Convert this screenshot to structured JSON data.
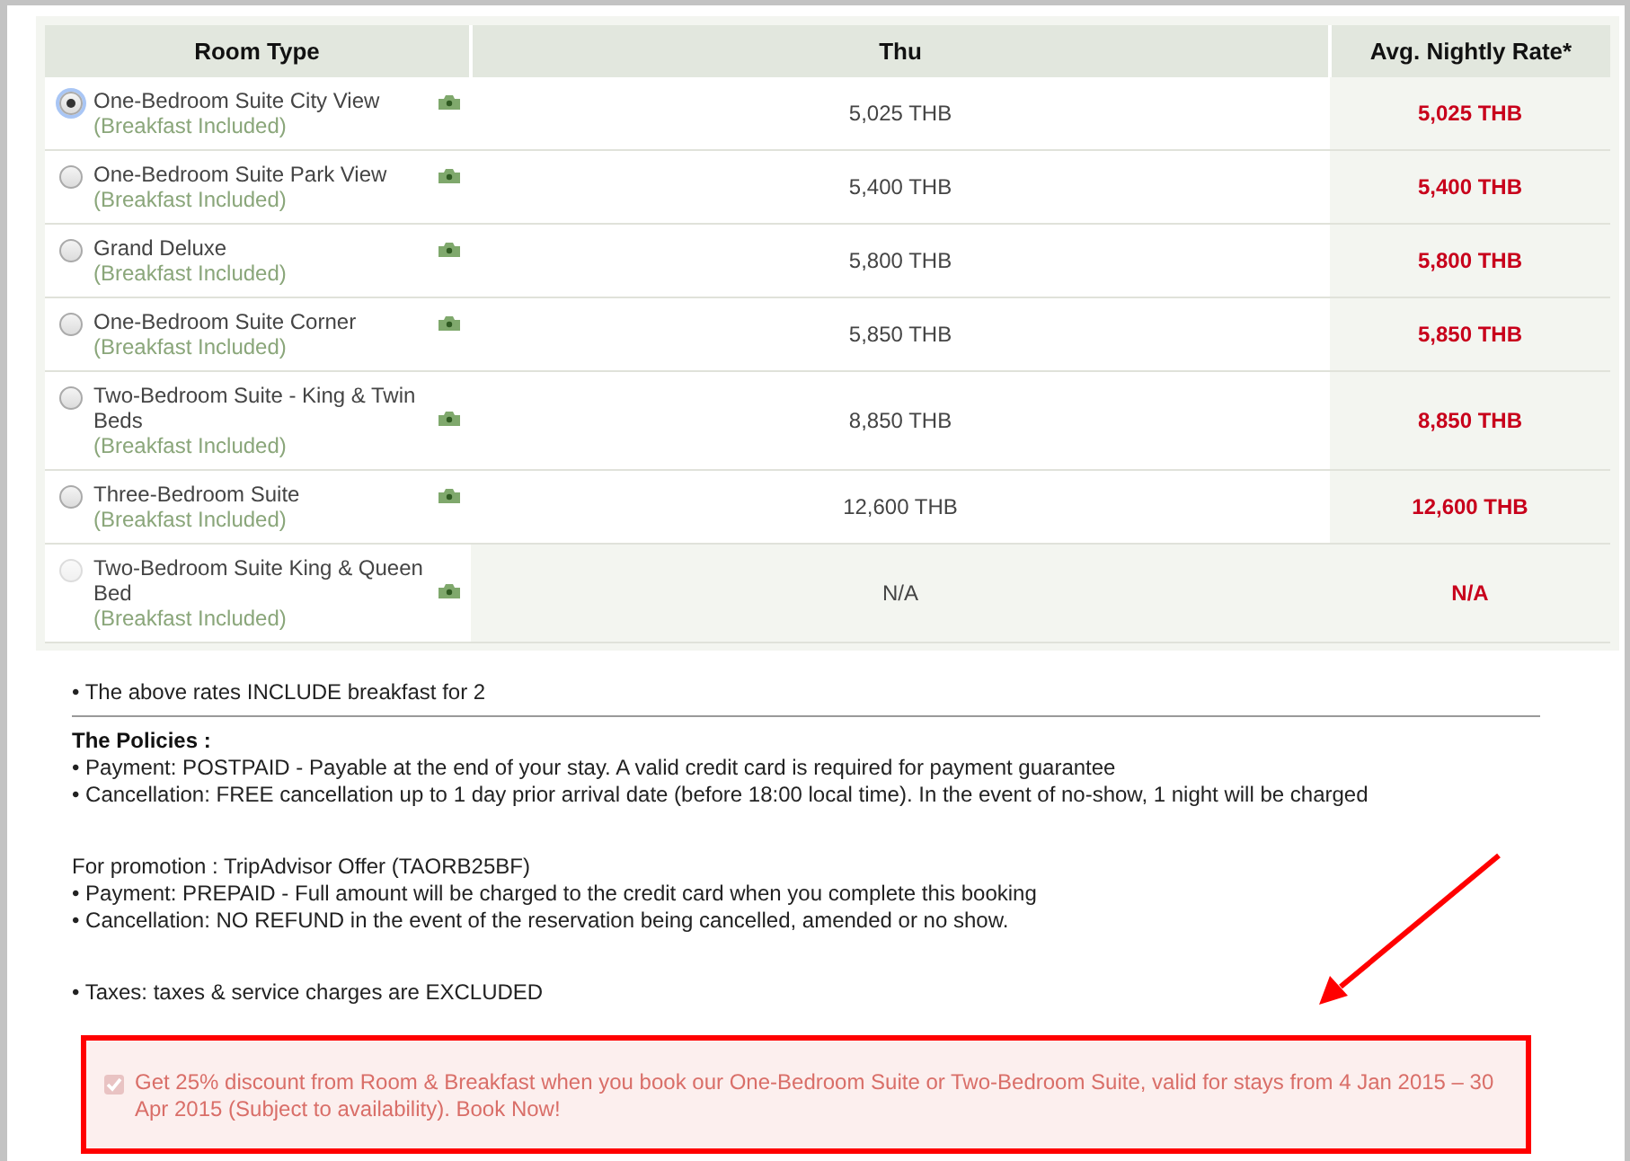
{
  "table": {
    "columns": [
      "Room Type",
      "Thu",
      "Avg. Nightly Rate*"
    ],
    "rows": [
      {
        "name": "One-Bedroom Suite City View",
        "note": "(Breakfast Included)",
        "selected": true,
        "available": true,
        "thu": "5,025 THB",
        "avg": "5,025 THB"
      },
      {
        "name": "One-Bedroom Suite Park View",
        "note": "(Breakfast Included)",
        "selected": false,
        "available": true,
        "thu": "5,400 THB",
        "avg": "5,400 THB"
      },
      {
        "name": "Grand Deluxe",
        "note": "(Breakfast Included)",
        "selected": false,
        "available": true,
        "thu": "5,800 THB",
        "avg": "5,800 THB"
      },
      {
        "name": "One-Bedroom Suite Corner",
        "note": "(Breakfast Included)",
        "selected": false,
        "available": true,
        "thu": "5,850 THB",
        "avg": "5,850 THB"
      },
      {
        "name": "Two-Bedroom Suite - King & Twin Beds",
        "note": "(Breakfast Included)",
        "selected": false,
        "available": true,
        "thu": "8,850 THB",
        "avg": "8,850 THB"
      },
      {
        "name": "Three-Bedroom Suite",
        "note": "(Breakfast Included)",
        "selected": false,
        "available": true,
        "thu": "12,600 THB",
        "avg": "12,600 THB"
      },
      {
        "name": "Two-Bedroom Suite King & Queen Bed",
        "note": "(Breakfast Included)",
        "selected": false,
        "available": false,
        "thu": "N/A",
        "avg": "N/A"
      }
    ]
  },
  "notes": [
    {
      "kind": "line",
      "text": "• The above rates INCLUDE breakfast for 2"
    },
    {
      "kind": "rule"
    },
    {
      "kind": "heading",
      "text": "The Policies :"
    },
    {
      "kind": "line",
      "text": "• Payment: POSTPAID - Payable at the end of your stay. A valid credit card is required for payment guarantee"
    },
    {
      "kind": "line",
      "text": "• Cancellation: FREE cancellation up to 1 day prior arrival date (before 18:00 local time). In the event of no-show, 1 night will be charged"
    },
    {
      "kind": "spacer"
    },
    {
      "kind": "line",
      "text": "For promotion : TripAdvisor Offer (TAORB25BF)"
    },
    {
      "kind": "line",
      "text": "• Payment: PREPAID - Full amount will be charged to the credit card when you complete this booking"
    },
    {
      "kind": "line",
      "text": "• Cancellation: NO REFUND in the event of the reservation being cancelled, amended or no show."
    },
    {
      "kind": "spacer"
    },
    {
      "kind": "line",
      "text": "• Taxes: taxes & service charges are EXCLUDED"
    }
  ],
  "promo": {
    "checked": true,
    "highlighted": true,
    "text": "Get 25% discount from Room & Breakfast when you book our One-Bedroom Suite or Two-Bedroom Suite, valid for stays from 4 Jan 2015 – 30 Apr 2015 (Subject to availability). Book Now!"
  }
}
